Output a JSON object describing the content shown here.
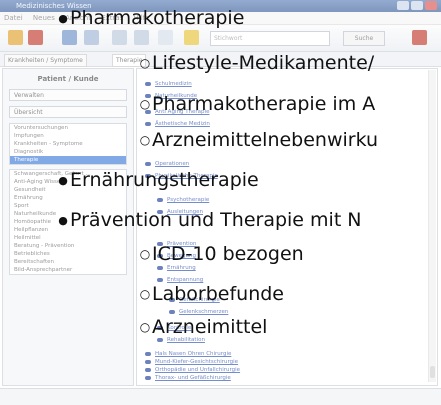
{
  "app": {
    "title": "Medizinisches Wissen",
    "menu": [
      "Datei",
      "Neues",
      "Ansicht",
      "Extras",
      "Hilfe"
    ],
    "search_placeholder": "Stichwort",
    "search_button": "Suche",
    "tabs": [
      "Krankheiten / Symptome",
      "Therapie"
    ],
    "left_heading": "Patient / Kunde",
    "left_buttons": [
      "Verwalten",
      "Übersicht"
    ],
    "left_items": [
      "Voruntersuchungen",
      "Impfungen",
      "Krankheiten - Symptome",
      "Diagnostik",
      "Therapie",
      "Schwangerschaft, Geburt ...",
      "Anti-Aging Wissen",
      "Gesundheit",
      "Ernährung",
      "Sport",
      "Naturheilkunde",
      "Homöopathie",
      "Heilpflanzen",
      "Heilmittel",
      "Beratung - Prävention",
      "Betriebliches",
      "Bereitschaften",
      "Bild-Ansprechpartner"
    ],
    "left_selected_index": 4,
    "right_items": [
      "Schulmedizin",
      "Naturheilkunde",
      "Anti Aging Therapie",
      "Ästhetische Medizin",
      "Operationen",
      "Physikalische Therapie",
      "Psychotherapie",
      "Ausleitungen",
      "Prävention",
      "Bewegung",
      "Ernährung",
      "Entspannung",
      "Gefäßchirurgie",
      "Gelenkschmerzen",
      "Kontrolle",
      "Rehabilitation",
      "Hals Nasen Ohren Chirurgie",
      "Mund-Kiefer-Gesichtschirurgie",
      "Orthopädie und Unfallchirurgie",
      "Thorax- und Gefäßchirurgie"
    ],
    "colors": {
      "accent": "#3d7bd9",
      "link": "#2a4fb0",
      "titlebar": "#3a5f99"
    }
  },
  "overlay": {
    "items": [
      {
        "level": 1,
        "text": "Pharmakotherapie"
      },
      {
        "level": 2,
        "text": "Lifestyle-Medikamente/"
      },
      {
        "level": 2,
        "text": "Pharmakotherapie im A"
      },
      {
        "level": 2,
        "text": "Arzneimittelnebenwirku"
      },
      {
        "level": 1,
        "text": "Ernährungstherapie"
      },
      {
        "level": 1,
        "text": "Prävention und Therapie mit N"
      },
      {
        "level": 2,
        "text": "ICD-10 bezogen"
      },
      {
        "level": 2,
        "text": "Laborbefunde"
      },
      {
        "level": 2,
        "text": "Arzneimittel"
      }
    ]
  }
}
